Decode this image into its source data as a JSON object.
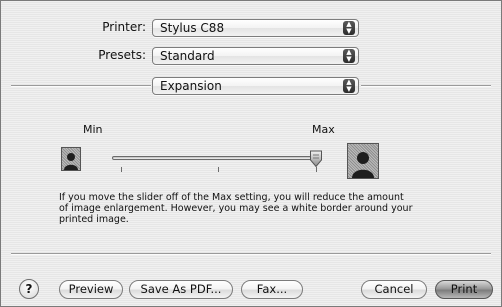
{
  "printer": {
    "label": "Printer:",
    "value": "Stylus C88"
  },
  "presets": {
    "label": "Presets:",
    "value": "Standard"
  },
  "panel": {
    "value": "Expansion"
  },
  "expansion": {
    "min_label": "Min",
    "max_label": "Max",
    "slider_level": "Max",
    "description": [
      "If you move the slider off of the Max setting, you will reduce the amount",
      "of image enlargement. However, you may see a white border around your",
      "printed image."
    ]
  },
  "buttons": {
    "help": "?",
    "preview": "Preview",
    "save_pdf": "Save As PDF...",
    "fax": "Fax...",
    "cancel": "Cancel",
    "print": "Print"
  },
  "icons": {
    "popup": "up-down-arrows-icon",
    "min": "small-portrait-icon",
    "max": "large-portrait-icon",
    "knob": "slider-knob-icon"
  }
}
